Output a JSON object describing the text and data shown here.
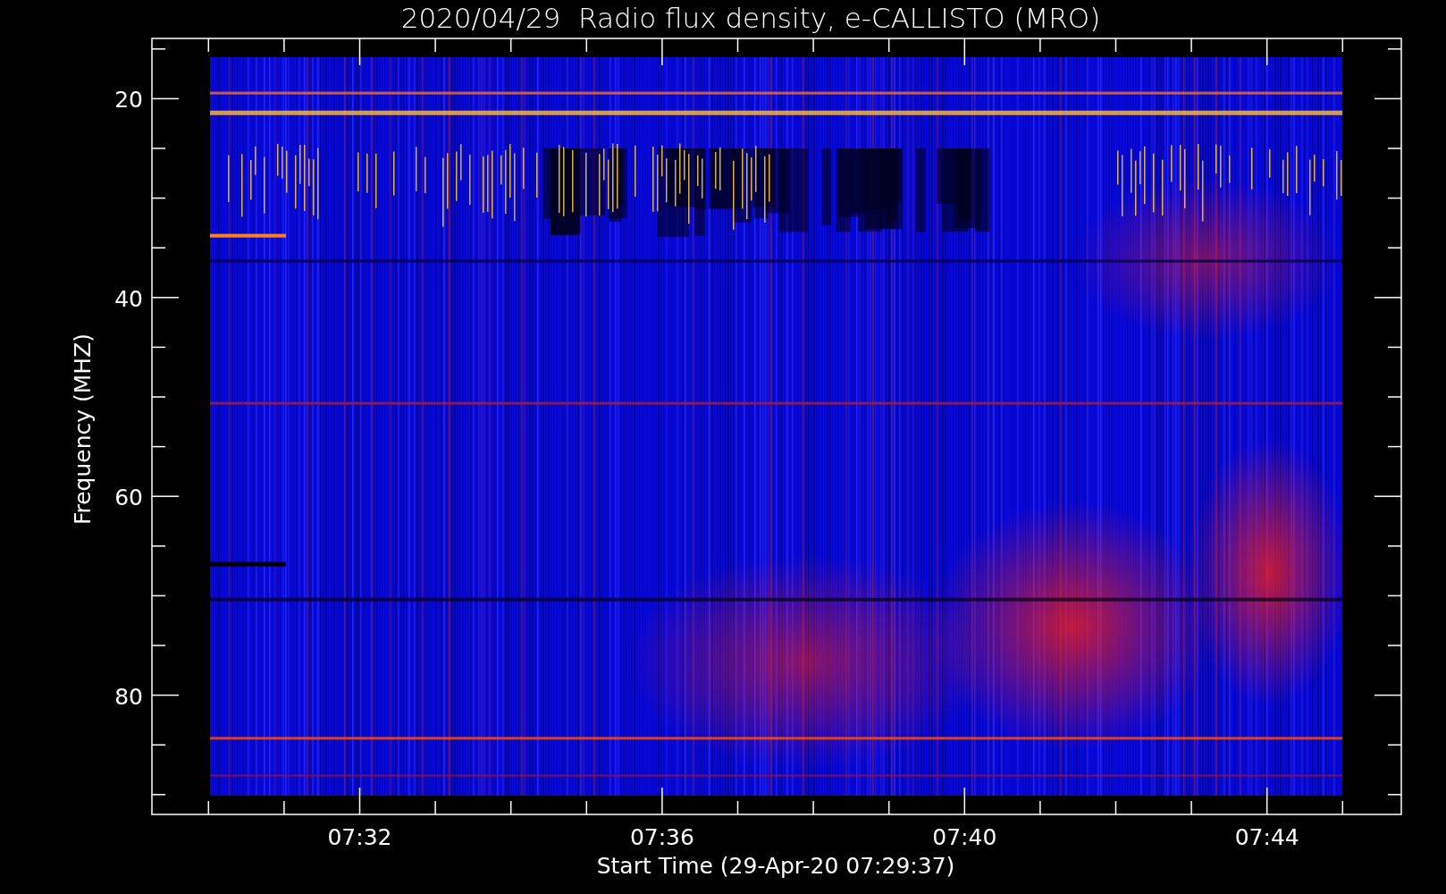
{
  "title": "2020/04/29  Radio flux density, e-CALLISTO (MRO)",
  "plot": {
    "ylabel": "Frequency (MHZ)",
    "xlabel": "Start Time (29-Apr-20 07:29:37)",
    "yticks": [
      "20",
      "40",
      "60",
      "80"
    ],
    "xticks": [
      "07:32",
      "07:36",
      "07:40",
      "07:44"
    ]
  }
}
